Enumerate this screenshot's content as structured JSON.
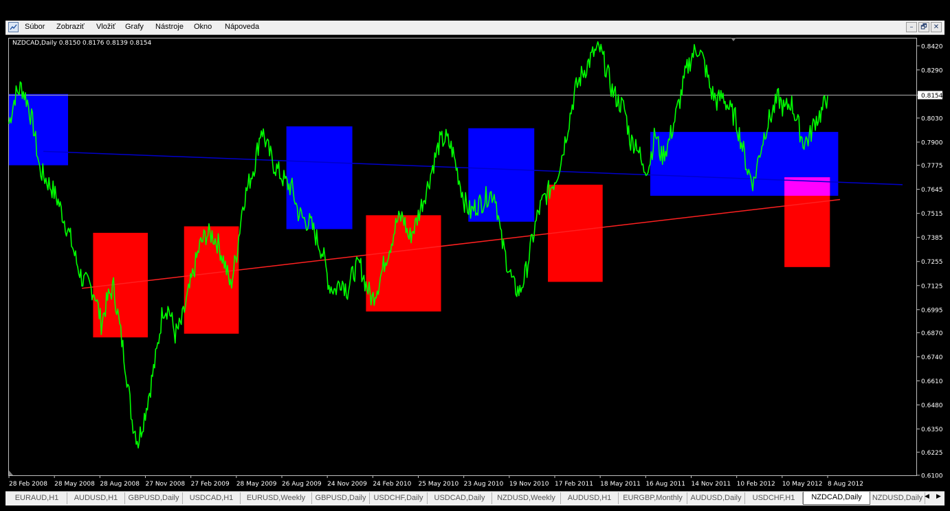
{
  "menu": {
    "items": [
      {
        "id": "subor",
        "label": "Súbor"
      },
      {
        "id": "zobrazit",
        "label": "Zobraziť"
      },
      {
        "id": "vlozit",
        "label": "Vložiť"
      },
      {
        "id": "grafy",
        "label": "Grafy"
      },
      {
        "id": "nastroje",
        "label": "Nástroje"
      },
      {
        "id": "okno",
        "label": "Okno"
      },
      {
        "id": "napoveda",
        "label": "Nápoveda"
      }
    ],
    "window_buttons": {
      "minimize": "–",
      "restore": "🗗",
      "close": "✕"
    }
  },
  "chart": {
    "symbol_header": "NZDCAD,Daily  0.8150 0.8176 0.8139 0.8154",
    "price_ticks": [
      "0.8420",
      "0.8290",
      "0.8154",
      "0.8030",
      "0.7900",
      "0.7775",
      "0.7645",
      "0.7515",
      "0.7385",
      "0.7255",
      "0.7125",
      "0.6995",
      "0.6870",
      "0.6740",
      "0.6610",
      "0.6480",
      "0.6350",
      "0.6225",
      "0.6100"
    ],
    "current_price": "0.8154",
    "date_ticks": [
      "28 Feb 2008",
      "28 May 2008",
      "28 Aug 2008",
      "27 Nov 2008",
      "27 Feb 2009",
      "28 May 2009",
      "26 Aug 2009",
      "24 Nov 2009",
      "24 Feb 2010",
      "25 May 2010",
      "23 Aug 2010",
      "19 Nov 2010",
      "17 Feb 2011",
      "18 May 2011",
      "16 Aug 2011",
      "14 Nov 2011",
      "10 Feb 2012",
      "10 May 2012",
      "8 Aug 2012"
    ],
    "colors": {
      "background": "#000000",
      "price_line": "#00ff00",
      "supply_zone": "#0000ff",
      "demand_zone": "#ff0000",
      "overlap_zone": "#ff00ff",
      "upper_trendline": "#0000cc",
      "lower_trendline": "#ff2020",
      "axis_text": "#ffffff"
    }
  },
  "chart_data": {
    "type": "line",
    "title": "NZDCAD,Daily",
    "ohlc_last": {
      "open": 0.815,
      "high": 0.8176,
      "low": 0.8139,
      "close": 0.8154
    },
    "ylim": [
      0.61,
      0.846
    ],
    "x_labels": [
      "28 Feb 2008",
      "28 May 2008",
      "28 Aug 2008",
      "27 Nov 2008",
      "27 Feb 2009",
      "28 May 2009",
      "26 Aug 2009",
      "24 Nov 2009",
      "24 Feb 2010",
      "25 May 2010",
      "23 Aug 2010",
      "19 Nov 2010",
      "17 Feb 2011",
      "18 May 2011",
      "16 Aug 2011",
      "14 Nov 2011",
      "10 Feb 2012",
      "10 May 2012",
      "8 Aug 2012"
    ],
    "series": [
      {
        "values": [
          0.8,
          0.815,
          0.82,
          0.812,
          0.798,
          0.775,
          0.77,
          0.765,
          0.758,
          0.748,
          0.738,
          0.725,
          0.715,
          0.713,
          0.708,
          0.692,
          0.705,
          0.712,
          0.69,
          0.668,
          0.64,
          0.628,
          0.642,
          0.658,
          0.676,
          0.7,
          0.7,
          0.686,
          0.692,
          0.706,
          0.72,
          0.734,
          0.74,
          0.74,
          0.735,
          0.725,
          0.712,
          0.73,
          0.757,
          0.768,
          0.779,
          0.798,
          0.787,
          0.778,
          0.773,
          0.768,
          0.765,
          0.752,
          0.748,
          0.746,
          0.738,
          0.73,
          0.713,
          0.71,
          0.716,
          0.71,
          0.72,
          0.724,
          0.713,
          0.705,
          0.713,
          0.725,
          0.735,
          0.747,
          0.75,
          0.738,
          0.745,
          0.756,
          0.766,
          0.779,
          0.79,
          0.792,
          0.786,
          0.772,
          0.758,
          0.752,
          0.756,
          0.758,
          0.762,
          0.762,
          0.737,
          0.724,
          0.712,
          0.709,
          0.72,
          0.737,
          0.752,
          0.76,
          0.765,
          0.772,
          0.785,
          0.802,
          0.818,
          0.826,
          0.832,
          0.838,
          0.84,
          0.83,
          0.818,
          0.812,
          0.808,
          0.79,
          0.79,
          0.775,
          0.778,
          0.795,
          0.782,
          0.788,
          0.8,
          0.813,
          0.828,
          0.837,
          0.841,
          0.832,
          0.818,
          0.812,
          0.815,
          0.808,
          0.803,
          0.79,
          0.775,
          0.768,
          0.785,
          0.798,
          0.806,
          0.814,
          0.807,
          0.812,
          0.802,
          0.79,
          0.792,
          0.802,
          0.806,
          0.815
        ]
      }
    ],
    "supply_zones": [
      {
        "from_label": "28 Feb 2008",
        "price_high": 0.816,
        "price_low": 0.7775
      },
      {
        "from_label": "26 Aug 2009",
        "price_high": 0.7985,
        "price_low": 0.743
      },
      {
        "from_label": "23 Aug 2010",
        "price_high": 0.7975,
        "price_low": 0.747
      },
      {
        "from_label": "16 Aug 2011",
        "price_high": 0.7955,
        "price_low": 0.761
      }
    ],
    "demand_zones": [
      {
        "from_label": "28 Aug 2008",
        "price_high": 0.741,
        "price_low": 0.6845
      },
      {
        "from_label": "27 Feb 2009",
        "price_high": 0.7445,
        "price_low": 0.6865
      },
      {
        "from_label": "24 Feb 2010",
        "price_high": 0.7505,
        "price_low": 0.6985
      },
      {
        "from_label": "17 Feb 2011",
        "price_high": 0.767,
        "price_low": 0.7145
      },
      {
        "from_label": "10 May 2012",
        "price_high": 0.771,
        "price_low": 0.7225
      }
    ],
    "trendlines": [
      {
        "name": "upper",
        "from_price": 0.785,
        "to_price": 0.767
      },
      {
        "name": "lower",
        "from_price": 0.711,
        "to_price": 0.759
      }
    ]
  },
  "tabs": [
    {
      "label": "EURAUD,H1",
      "active": false
    },
    {
      "label": "AUDUSD,H1",
      "active": false
    },
    {
      "label": "GBPUSD,Daily",
      "active": false
    },
    {
      "label": "USDCAD,H1",
      "active": false
    },
    {
      "label": "EURUSD,Weekly",
      "active": false
    },
    {
      "label": "GBPUSD,Daily",
      "active": false
    },
    {
      "label": "USDCHF,Daily",
      "active": false
    },
    {
      "label": "USDCAD,Daily",
      "active": false
    },
    {
      "label": "NZDUSD,Weekly",
      "active": false
    },
    {
      "label": "AUDUSD,H1",
      "active": false
    },
    {
      "label": "EURGBP,Monthly",
      "active": false
    },
    {
      "label": "AUDUSD,Daily",
      "active": false
    },
    {
      "label": "USDCHF,H1",
      "active": false
    },
    {
      "label": "NZDCAD,Daily",
      "active": true
    },
    {
      "label": "NZDUSD,Daily",
      "active": false
    }
  ],
  "tab_scroll": {
    "left": "◀",
    "right": "▶"
  }
}
